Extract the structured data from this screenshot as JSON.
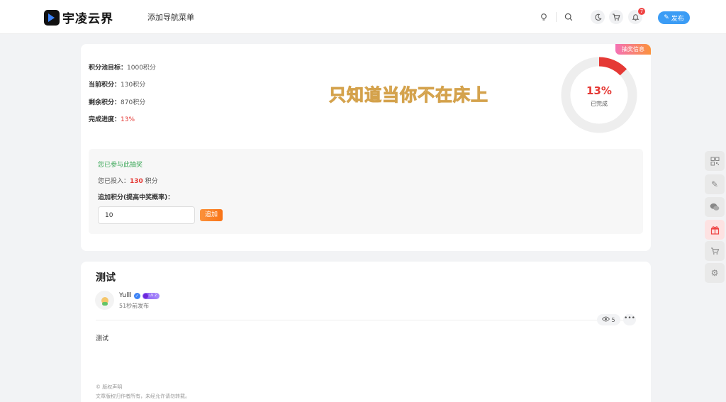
{
  "header": {
    "logo_text": "宇凌云界",
    "nav_item": "添加导航菜单",
    "notification_count": "7",
    "publish_label": "发布"
  },
  "lottery": {
    "corner_tag": "抽奖信息",
    "stats": [
      {
        "label": "积分池目标：",
        "value": "1000积分"
      },
      {
        "label": "当前积分：",
        "value": "130积分"
      },
      {
        "label": "剩余积分：",
        "value": "870积分"
      },
      {
        "label": "完成进度：",
        "value": "13%"
      }
    ],
    "watermark": "只知道当你不在床上",
    "progress_percent": 13,
    "progress_label": "13%",
    "progress_sub": "已完成",
    "colors": {
      "accent": "#e53935",
      "ring_track": "#eeeeee",
      "joined": "#3aa757"
    },
    "joined_text": "您已参与此抽奖",
    "invested_prefix": "您已投入：",
    "invested_value": "130",
    "invested_suffix": " 积分",
    "add_label": "追加积分(提高中奖概率)：",
    "input_value": "10",
    "add_button": "追加"
  },
  "post": {
    "title": "测试",
    "author": "Yulll",
    "level": "LV 2",
    "time": "51秒前发布",
    "views": "5",
    "more": "•••",
    "content": "测试",
    "copyright_title": "© 版权声明",
    "copyright_note": "文章版权归作者所有，未经允许请勿转载。"
  }
}
